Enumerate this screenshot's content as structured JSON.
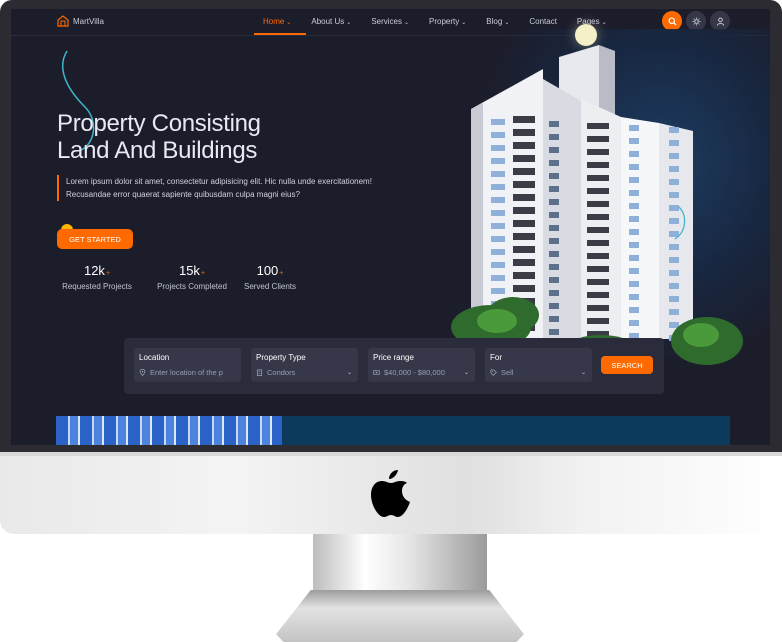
{
  "nav": {
    "brand": "MartVilla",
    "items": [
      {
        "label": "Home",
        "active": true,
        "has_caret": true
      },
      {
        "label": "About Us",
        "has_caret": true
      },
      {
        "label": "Services",
        "has_caret": true
      },
      {
        "label": "Property",
        "has_caret": true
      },
      {
        "label": "Blog",
        "has_caret": true
      },
      {
        "label": "Contact",
        "has_caret": false
      },
      {
        "label": "Pages",
        "has_caret": true
      }
    ],
    "buttons": [
      "search-icon",
      "sun-icon",
      "user-icon"
    ]
  },
  "hero": {
    "title_line1": "Property Consisting",
    "title_line2": "Land And Buildings",
    "description": "Lorem ipsum dolor sit amet, consectetur adipisicing elit. Hic nulla unde exercitationem! Recusandae error quaerat sapiente quibusdam culpa magni eius?",
    "cta_label": "GET STARTED",
    "stats": [
      {
        "value": "12k",
        "suffix": "+",
        "label": "Requested Projects"
      },
      {
        "value": "15k",
        "suffix": "+",
        "label": "Projects Completed"
      },
      {
        "value": "100",
        "suffix": "+",
        "label": "Served Clients"
      }
    ]
  },
  "search": {
    "location_label": "Location",
    "location_placeholder": "Enter location of the p",
    "type_label": "Property Type",
    "type_value": "Condors",
    "price_label": "Price range",
    "price_value": "$40,000 - $80,000",
    "for_label": "For",
    "for_value": "Sell",
    "button_label": "SEARCH"
  },
  "colors": {
    "accent": "#ff6a00",
    "background": "#1c1d2b",
    "panel": "#2a2c3c"
  }
}
